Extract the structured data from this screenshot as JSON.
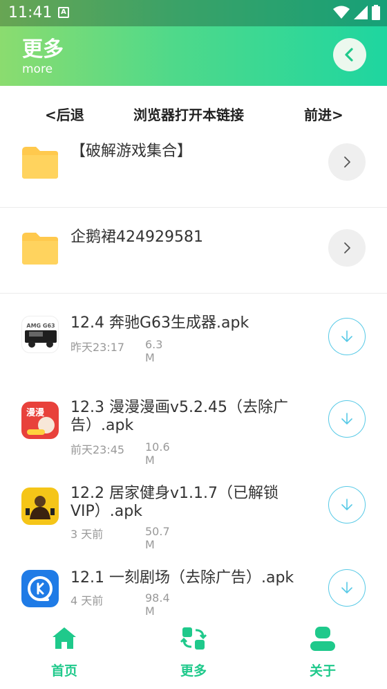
{
  "status_bar": {
    "time": "11:41",
    "a_icon": "A"
  },
  "header": {
    "title": "更多",
    "subtitle": "more"
  },
  "browser_nav": {
    "back": "<后退",
    "open": "浏览器打开本链接",
    "forward": "前进>"
  },
  "items": [
    {
      "type": "folder",
      "title": "【破解游戏集合】"
    },
    {
      "type": "folder",
      "title": "企鹅裙424929581"
    },
    {
      "type": "file",
      "title": "12.4 奔驰G63生成器.apk",
      "date": "昨天23:17",
      "size": "6.3 M",
      "icon_text": "AMG G63"
    },
    {
      "type": "file",
      "title": "12.3 漫漫漫画v5.2.45（去除广告）.apk",
      "date": "前天23:45",
      "size": "10.6 M",
      "icon_text": "漫漫"
    },
    {
      "type": "file",
      "title": "12.2 居家健身v1.1.7（已解锁VIP）.apk",
      "date": "3 天前",
      "size": "50.7 M"
    },
    {
      "type": "file",
      "title": "12.1 一刻剧场（去除广告）.apk",
      "date": "4 天前",
      "size": "98.4 M"
    }
  ],
  "bottom_nav": {
    "home": "首页",
    "more": "更多",
    "about": "关于"
  },
  "colors": {
    "accent": "#1fc98b",
    "download": "#56c9e6",
    "folder": "#ffc94d"
  }
}
